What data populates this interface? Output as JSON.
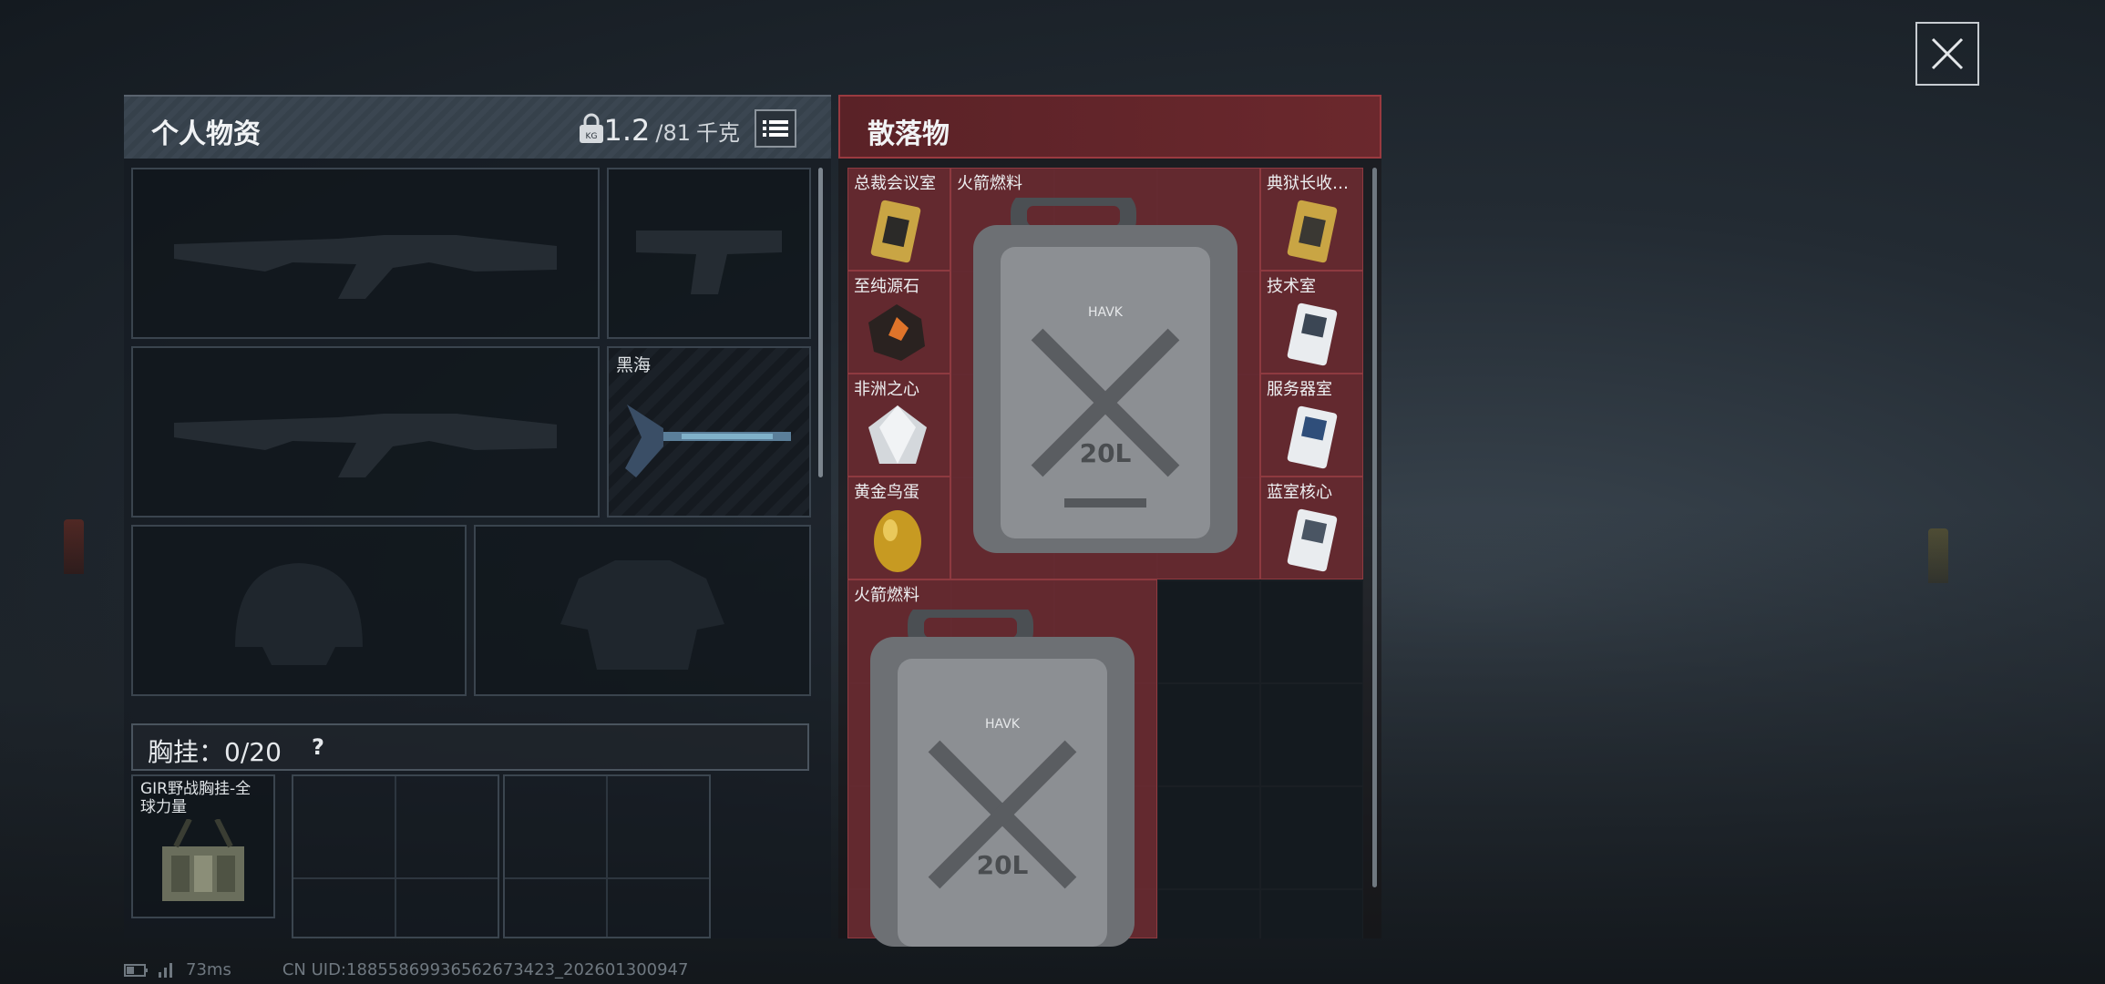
{
  "left_panel": {
    "title": "个人物资",
    "weight_current": "1.2",
    "weight_max": "/81",
    "weight_unit": "千克",
    "slots": [
      {
        "name": "primary-weapon-1",
        "label": ""
      },
      {
        "name": "pistol",
        "label": ""
      },
      {
        "name": "primary-weapon-2",
        "label": ""
      },
      {
        "name": "melee",
        "label": "黑海"
      },
      {
        "name": "helmet",
        "label": ""
      },
      {
        "name": "armor",
        "label": ""
      }
    ],
    "chest_rig": {
      "label": "胸挂：0/20",
      "help": "?",
      "item_label": "GIR野战胸挂-全球力量"
    }
  },
  "right_panel": {
    "title": "散落物",
    "items": [
      {
        "label": "总裁会议室",
        "icon": "gold-keycard-icon"
      },
      {
        "label": "火箭燃料",
        "icon": "fuel-canister-icon"
      },
      {
        "label": "典狱长收…",
        "icon": "gold-keycard-icon"
      },
      {
        "label": "至纯源石",
        "icon": "ore-gem-icon"
      },
      {
        "label": "技术室",
        "icon": "white-keycard-icon"
      },
      {
        "label": "非洲之心",
        "icon": "diamond-icon"
      },
      {
        "label": "服务器室",
        "icon": "white-keycard-icon"
      },
      {
        "label": "黄金鸟蛋",
        "icon": "golden-egg-icon"
      },
      {
        "label": "蓝室核心",
        "icon": "white-keycard-icon"
      },
      {
        "label": "火箭燃料",
        "icon": "fuel-canister-icon"
      }
    ],
    "canister_text": "20L",
    "canister_brand": "HAVK"
  },
  "footer": {
    "ping": "73ms",
    "uid": "CN UID:18855869936562673423_202601300947"
  },
  "colors": {
    "loot_red": "#7a2e34",
    "header_red": "#6b282d"
  }
}
